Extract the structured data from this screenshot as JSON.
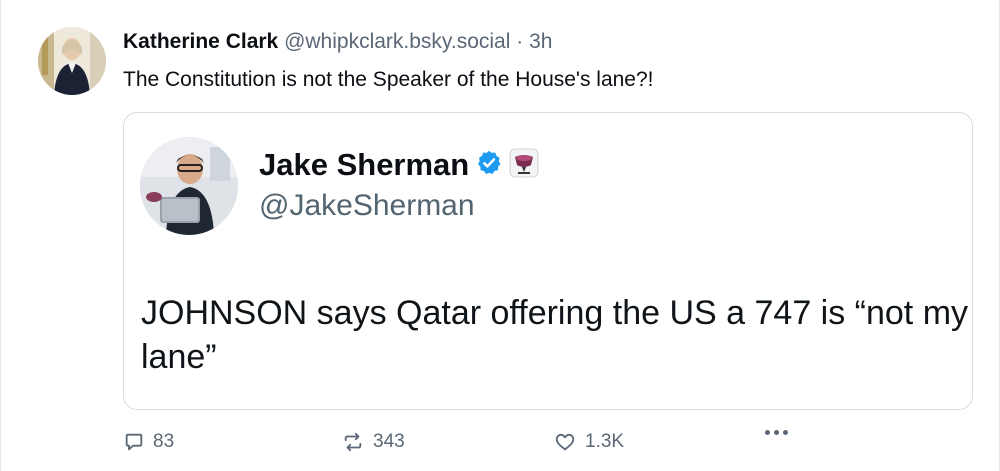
{
  "post": {
    "author_name": "Katherine Clark",
    "handle": "@whipkclark.bsky.social",
    "separator": "·",
    "time": "3h",
    "text": "The Constitution is not the Speaker of the House's lane?!"
  },
  "quote": {
    "name": "Jake Sherman",
    "handle": "@JakeSherman",
    "text": "JOHNSON says Qatar offering the US a 747 is “not my lane”",
    "verified_badge_color": "#1d9bf0"
  },
  "actions": {
    "replies": "83",
    "reposts": "343",
    "likes": "1.3K"
  },
  "colors": {
    "text_primary": "#0b0f14",
    "text_secondary": "#5b6776",
    "border": "#d6dbe2"
  }
}
